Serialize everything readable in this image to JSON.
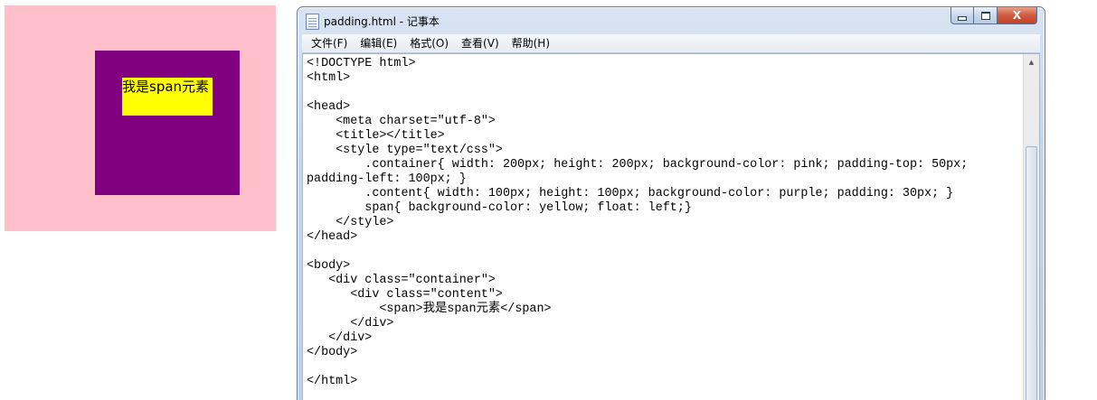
{
  "preview": {
    "span_text": "我是span元素",
    "colors": {
      "container": "#ffc0cb",
      "content": "#800080",
      "span": "#ffff00"
    }
  },
  "window": {
    "title": "padding.html - 记事本",
    "icon": "notepad-icon",
    "controls": {
      "minimize_icon": "minimize-icon",
      "maximize_icon": "maximize-icon",
      "close_label": "X"
    }
  },
  "menu": [
    {
      "label": "文件(F)"
    },
    {
      "label": "编辑(E)"
    },
    {
      "label": "格式(O)"
    },
    {
      "label": "查看(V)"
    },
    {
      "label": "帮助(H)"
    }
  ],
  "code_lines": [
    "<!DOCTYPE html>",
    "<html>",
    "",
    "<head>",
    "    <meta charset=\"utf-8\">",
    "    <title></title>",
    "    <style type=\"text/css\">",
    "        .container{ width: 200px; height: 200px; background-color: pink; padding-top: 50px;",
    "padding-left: 100px; }",
    "        .content{ width: 100px; height: 100px; background-color: purple; padding: 30px; }",
    "        span{ background-color: yellow; float: left;}",
    "    </style>",
    "</head>",
    "",
    "<body>",
    "   <div class=\"container\">",
    "      <div class=\"content\">",
    "          <span>我是span元素</span>",
    "      </div>",
    "   </div>",
    "</body>",
    "",
    "</html>"
  ],
  "scrollbar": {
    "up_icon": "scroll-up-arrow-icon"
  }
}
